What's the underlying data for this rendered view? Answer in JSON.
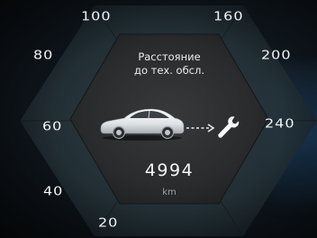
{
  "speedometer": {
    "ticks": [
      "100",
      "160",
      "80",
      "200",
      "60",
      "240",
      "40",
      "20"
    ]
  },
  "service_panel": {
    "title_line1": "Расстояние",
    "title_line2": "до тех. обсл.",
    "distance_value": "4994",
    "distance_unit": "km",
    "icons": [
      "car-icon",
      "dashed-arrow-icon",
      "wrench-icon"
    ]
  },
  "colors": {
    "text": "#f2f5f7",
    "unit_text": "#9aa3aa",
    "gauge_ring": "#233238",
    "inner_panel": "#2b2c2e"
  }
}
